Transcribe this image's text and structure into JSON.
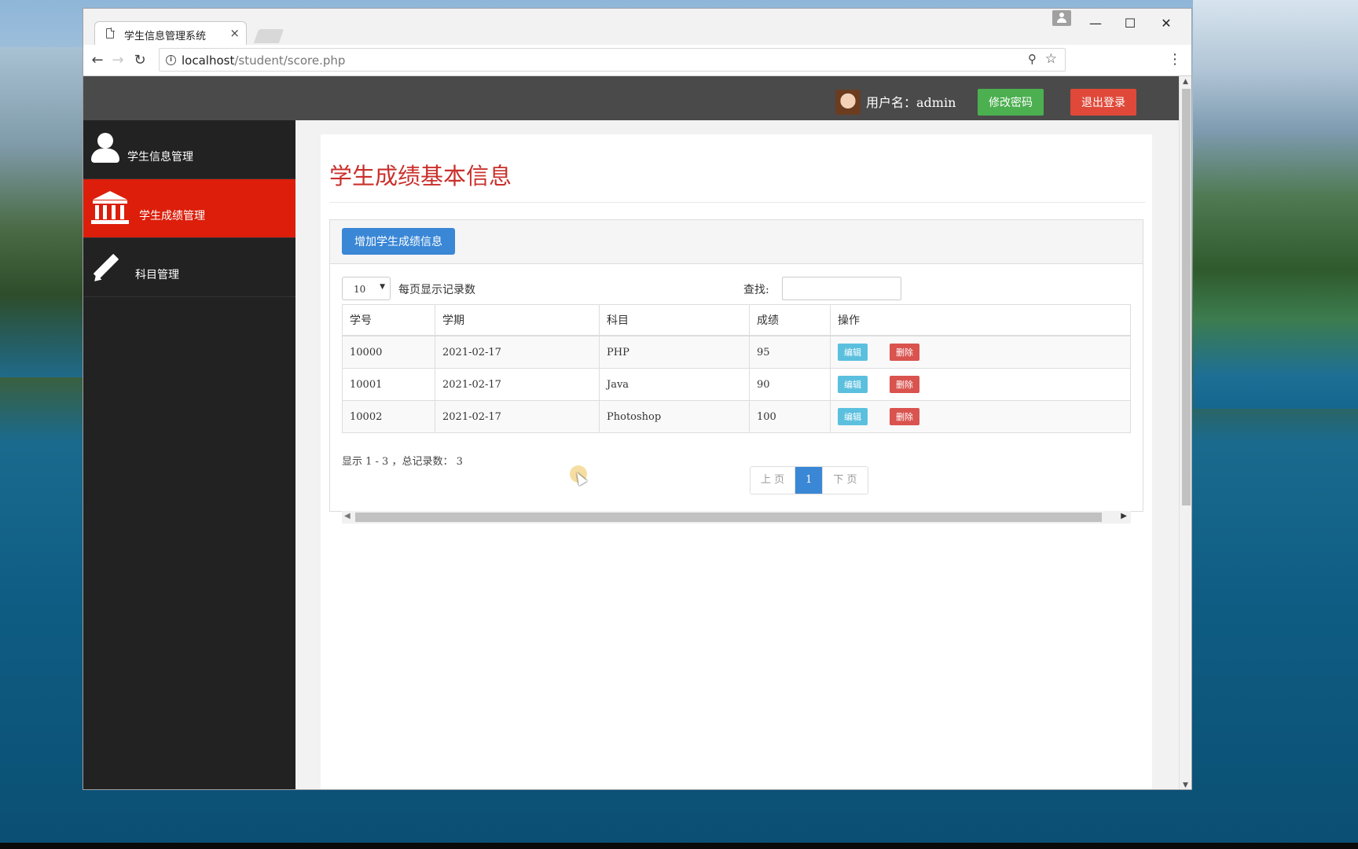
{
  "browser": {
    "tab_title": "学生信息管理系统",
    "tab_close": "×",
    "url_host": "localhost",
    "url_path": "/student/score.php",
    "window_controls": {
      "minimize": "—",
      "maximize": "☐",
      "close": "✕"
    },
    "nav": {
      "back": "←",
      "forward": "→",
      "reload": "↻",
      "menu": "⋮",
      "zoom": "⚲",
      "star": "☆"
    }
  },
  "topnav": {
    "username": "用户名：admin",
    "change_password_label": "修改密码",
    "logout_label": "退出登录"
  },
  "sidebar": {
    "items": [
      {
        "label": "学生信息管理",
        "icon": "user-icon",
        "active": false
      },
      {
        "label": "学生成绩管理",
        "icon": "bank-icon",
        "active": true
      },
      {
        "label": "科目管理",
        "icon": "pencil-icon",
        "active": false
      }
    ]
  },
  "main": {
    "title": "学生成绩基本信息",
    "add_button_label": "增加学生成绩信息",
    "page_length_value": "10",
    "page_length_label": "每页显示记录数",
    "search_label": "查找:",
    "search_value": "",
    "table": {
      "headers": [
        "学号",
        "学期",
        "科目",
        "成绩",
        "操作"
      ],
      "rows": [
        {
          "id": "10000",
          "term": "2021-02-17",
          "subject": "PHP",
          "score": "95"
        },
        {
          "id": "10001",
          "term": "2021-02-17",
          "subject": "Java",
          "score": "90"
        },
        {
          "id": "10002",
          "term": "2021-02-17",
          "subject": "Photoshop",
          "score": "100"
        }
      ],
      "edit_label": "编辑",
      "delete_label": "删除"
    },
    "info_text": "显示 1 - 3 ，总记录数： 3",
    "pagination": {
      "prev": "上 页",
      "current": "1",
      "next": "下 页"
    }
  },
  "colors": {
    "accent_red": "#dc1e0b",
    "title_red": "#c9302c",
    "primary_blue": "#3a87d6",
    "success_green": "#4caf50",
    "danger_red": "#d9534f",
    "info_cyan": "#5bc0de",
    "sidebar_bg": "#222222",
    "topbar_bg": "#4a4a4a"
  }
}
